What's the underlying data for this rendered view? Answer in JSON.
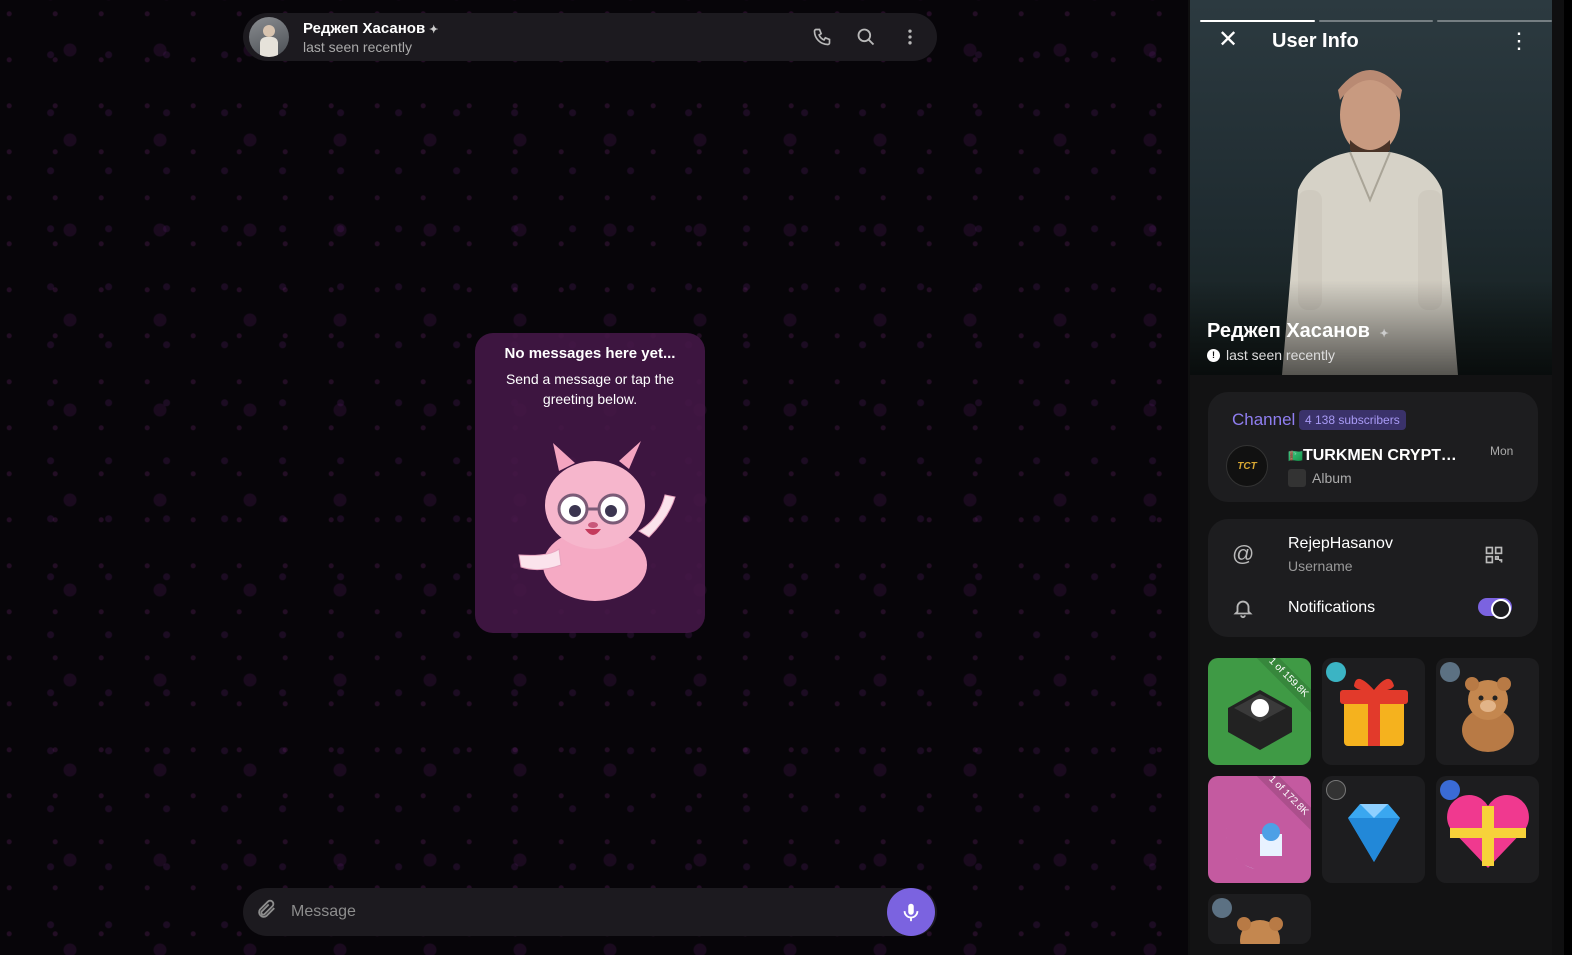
{
  "chat_header": {
    "name": "Реджеп Хасанов",
    "status": "last seen recently"
  },
  "empty_state": {
    "title": "No messages here yet...",
    "subtitle": "Send a message or tap the greeting below."
  },
  "composer": {
    "placeholder": "Message"
  },
  "user_info": {
    "title": "User Info",
    "name": "Реджеп Хасанов",
    "status": "last seen recently",
    "story_segments": 3,
    "channel": {
      "label": "Channel",
      "subscribers": "4 138 subscribers",
      "name": "TURKMEN CRYPTO ...",
      "logo_text": "TCT",
      "last_post": "Album",
      "time": "Mon"
    },
    "username": {
      "value": "RejepHasanov",
      "label": "Username"
    },
    "notifications": {
      "label": "Notifications",
      "enabled": true
    },
    "gifts": [
      {
        "name": "keycap-gift",
        "ribbon": "1 of 159.8K"
      },
      {
        "name": "gift-box"
      },
      {
        "name": "teddy-bear"
      },
      {
        "name": "moon-mosque-gift",
        "ribbon": "1 of 172.8K"
      },
      {
        "name": "diamond"
      },
      {
        "name": "heart-gift"
      },
      {
        "name": "teddy-bear-partial"
      }
    ]
  },
  "colors": {
    "accent": "#7b63e0",
    "channel_label": "#8f7ef0"
  }
}
